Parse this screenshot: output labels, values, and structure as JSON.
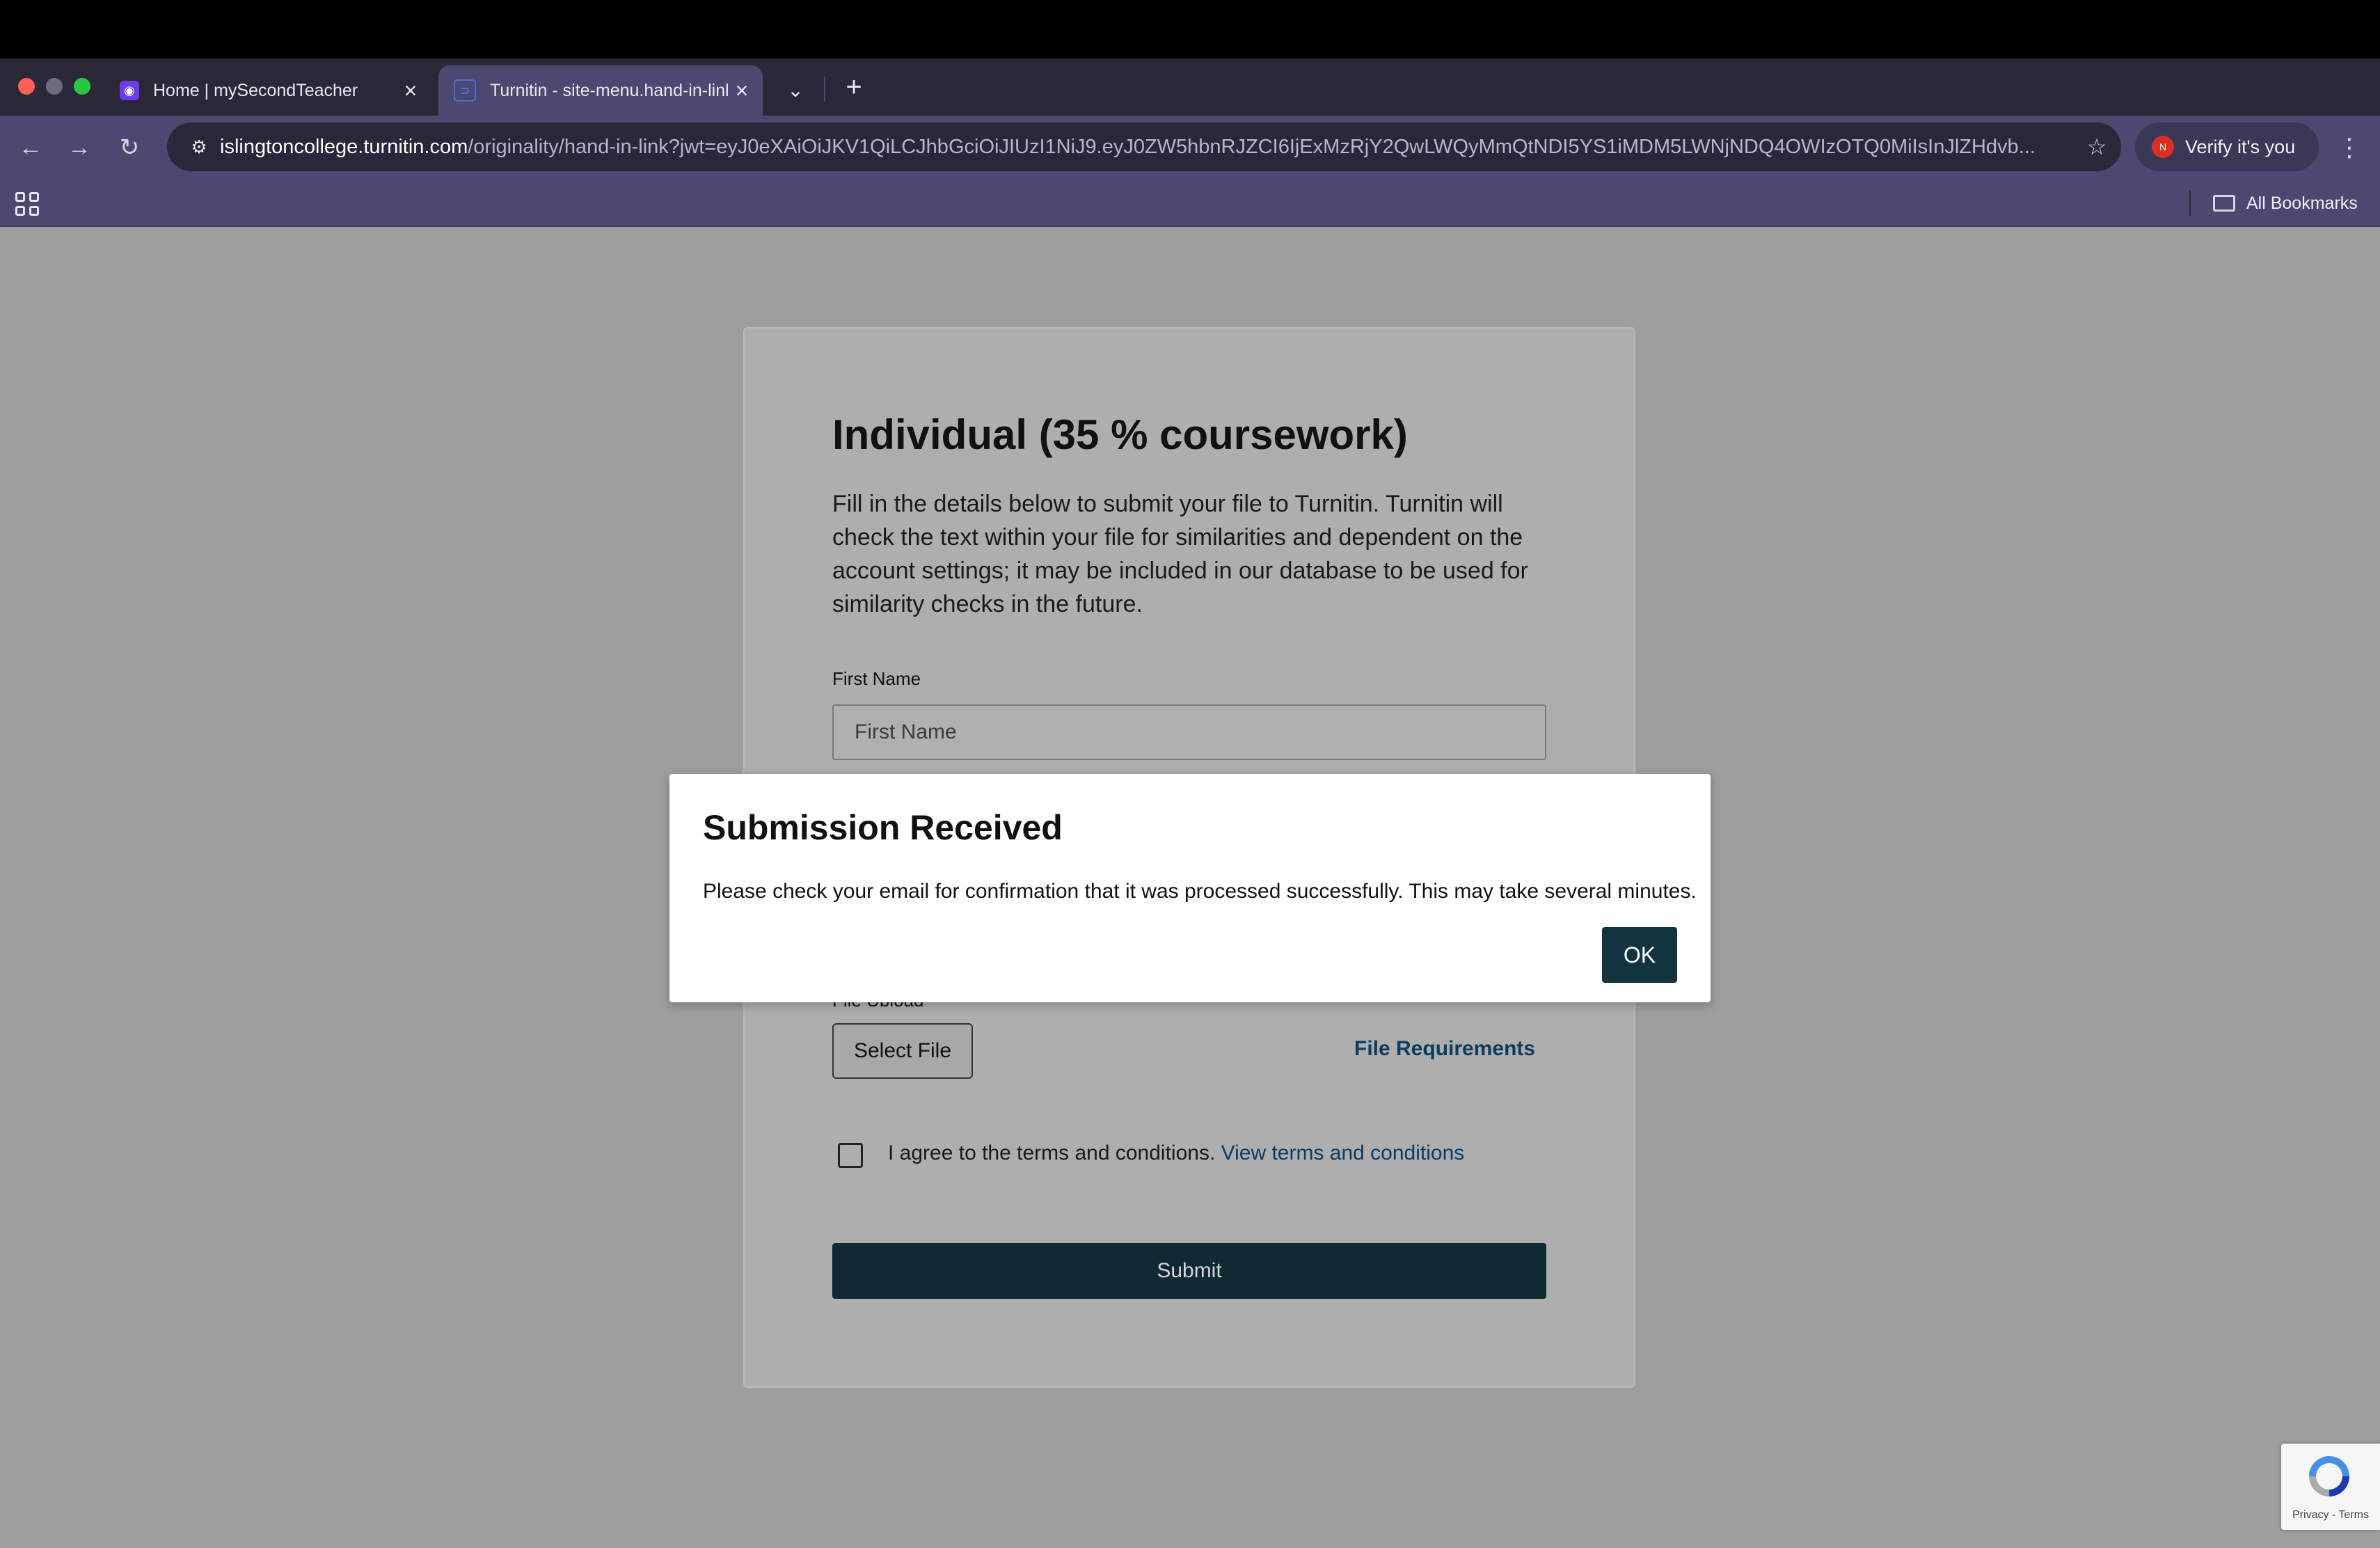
{
  "browser": {
    "tabs": [
      {
        "title": "Home | mySecondTeacher",
        "favicon_color": "#6a3de8"
      },
      {
        "title": "Turnitin - site-menu.hand-in-link",
        "favicon_color": "#4a6ee0"
      }
    ],
    "url_host": "islingtoncollege.turnitin.com",
    "url_path": "/originality/hand-in-link?jwt=eyJ0eXAiOiJKV1QiLCJhbGciOiJIUzI1NiJ9.eyJ0ZW5hbnRJZCI6IjExMzRjY2QwLWQyMmQtNDI5YS1iMDM5LWNjNDQ4OWIzOTQ0MiIsInJlZHdvb...",
    "verify_label": "Verify it's you",
    "verify_avatar": "N",
    "all_bookmarks_label": "All Bookmarks",
    "new_tab_symbol": "+",
    "close_symbol": "×"
  },
  "form": {
    "title": "Individual (35 % coursework)",
    "description": "Fill in the details below to submit your file to Turnitin. Turnitin will check the text within your file for similarities and dependent on the account settings; it may be included in our database to be used for similarity checks in the future.",
    "first_name_label": "First Name",
    "first_name_placeholder": "First Name",
    "file_upload_label": "File Upload",
    "select_file_label": "Select File",
    "file_requirements_label": "File Requirements",
    "terms_text": "I agree to the terms and conditions.",
    "terms_link": "View terms and conditions",
    "submit_label": "Submit"
  },
  "modal": {
    "title": "Submission Received",
    "message": "Please check your email for confirmation that it was processed successfully. This may take several minutes.",
    "ok_label": "OK"
  },
  "recaptcha": {
    "links": "Privacy - Terms"
  },
  "colors": {
    "tab_strip": "#2a2739",
    "toolbar": "#4c4870",
    "submit_bg": "#0f2a33",
    "link": "#0b3c62",
    "overlay_bg": "#9e9e9e"
  }
}
